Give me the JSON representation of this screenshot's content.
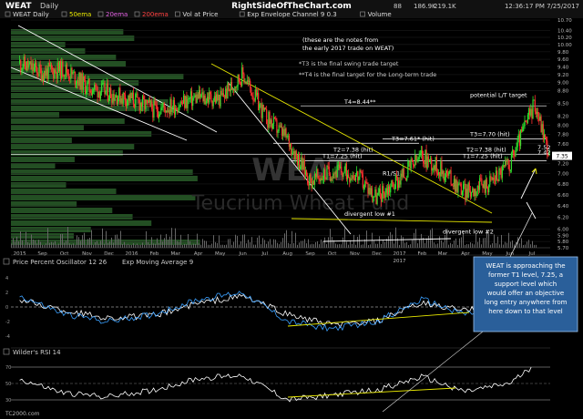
{
  "header": {
    "symbol": "WEAT",
    "period": "Daily",
    "brand": "RightSideOfTheChart.com",
    "stats": [
      "88",
      "186.9K",
      "219.1K"
    ],
    "time": "12:36:17 PM 7/25/2017",
    "legend": [
      {
        "text": "WEAT Daily",
        "color": "#dddddd"
      },
      {
        "text": "50ema",
        "color": "#e8e800"
      },
      {
        "text": "20ema",
        "color": "#e060e0"
      },
      {
        "text": "200ema",
        "color": "#ff4040"
      },
      {
        "text": "Vol at Price",
        "color": "#dddddd"
      },
      {
        "text": "Exp Envelope Channel 9 0.3",
        "color": "#dddddd"
      },
      {
        "text": "Volume",
        "color": "#dddddd"
      }
    ]
  },
  "watermark": {
    "ticker": "WEAT",
    "name": "Teucrium Wheat Fund"
  },
  "notes": {
    "intro": [
      "(these are the notes from",
      "the early 2017 trade on WEAT)"
    ],
    "t3": "*T3 is the final swing trade target",
    "t4": "**T4 is the final target for the Long-term trade"
  },
  "annotations": {
    "t4": "T4=8.44**",
    "potential": "potential L/T target",
    "t3_left": "T3=7.61* (hit)",
    "t3_right": "T3=7.70 (hit)",
    "t2_left": "T2=7.38 (hit)",
    "t2_right": "T2=7.38 (hit)",
    "t1_left": "T1=7.25 (hit)",
    "t1_right": "T1=7.25 (hit)",
    "r1s1": "R1/S1",
    "div1": "divergent low #1",
    "div2": "divergent low #2",
    "year2017": "2017"
  },
  "callout": "WEAT is approaching the former T1 level, 7.25, a support level which would offer an objective long entry anywhere from here down to that level",
  "price_tags": {
    "current": "7.35",
    "upper": "7.52",
    "mid": "7.42"
  },
  "indicators": {
    "ppo": {
      "title": "Price Percent Oscillator 12 26",
      "extra": "Exp Moving Average 9"
    },
    "rsi": {
      "title": "Wilder's RSI 14"
    }
  },
  "footer": {
    "credit": "TC2000.com"
  },
  "colors": {
    "background": "#000000",
    "up_candle": "#2ee02e",
    "down_candle": "#ff3030",
    "target_lines": "#ffffff",
    "trendline_yellow": "#e8e800",
    "callout_bg": "#2a5f9a",
    "volume_at_price": "#2f6a2f"
  },
  "chart_data": [
    {
      "type": "line",
      "title": "WEAT Daily",
      "x_labels": [
        "2015",
        "Sep",
        "Oct",
        "Nov",
        "Dec",
        "2016",
        "Feb",
        "Mar",
        "Apr",
        "May",
        "Jun",
        "Jul",
        "Aug",
        "Sep",
        "Oct",
        "Nov",
        "Dec",
        "2017",
        "Feb",
        "Mar",
        "Apr",
        "May",
        "Jun",
        "Jul"
      ],
      "y_ticks": [
        5.7,
        5.8,
        5.9,
        6.0,
        6.2,
        6.4,
        6.6,
        6.8,
        7.0,
        7.2,
        7.4,
        7.6,
        7.8,
        8.0,
        8.2,
        8.5,
        8.8,
        9.0,
        9.2,
        9.4,
        9.6,
        9.8,
        10.0,
        10.2,
        10.4,
        10.7
      ],
      "ylim": [
        5.7,
        10.7
      ],
      "scale": "log",
      "series": [
        {
          "name": "WEAT",
          "points": [
            [
              "2015-08",
              9.5
            ],
            [
              "2015-09",
              9.25
            ],
            [
              "2015-10",
              9.35
            ],
            [
              "2015-11",
              8.9
            ],
            [
              "2015-12",
              8.75
            ],
            [
              "2016-01",
              8.6
            ],
            [
              "2016-02",
              8.35
            ],
            [
              "2016-03",
              8.45
            ],
            [
              "2016-04",
              8.65
            ],
            [
              "2016-05",
              8.6
            ],
            [
              "2016-06",
              9.2
            ],
            [
              "2016-07",
              8.2
            ],
            [
              "2016-08",
              7.7
            ],
            [
              "2016-09",
              6.85
            ],
            [
              "2016-10",
              7.05
            ],
            [
              "2016-11",
              7.0
            ],
            [
              "2016-12",
              6.55
            ],
            [
              "2017-01",
              6.9
            ],
            [
              "2017-02",
              7.35
            ],
            [
              "2017-03",
              7.05
            ],
            [
              "2017-04",
              6.65
            ],
            [
              "2017-05",
              6.8
            ],
            [
              "2017-06",
              7.2
            ],
            [
              "2017-07-05",
              8.5
            ],
            [
              "2017-07-25",
              7.35
            ]
          ]
        }
      ],
      "levels": [
        8.44,
        7.61,
        7.7,
        7.38,
        7.25
      ],
      "grid": true
    },
    {
      "type": "line",
      "title": "Price Percent Oscillator 12 26",
      "x": [
        "2015-08",
        "2015-10",
        "2015-12",
        "2016-02",
        "2016-04",
        "2016-06",
        "2016-08",
        "2016-10",
        "2016-12",
        "2017-02",
        "2017-04",
        "2017-06",
        "2017-07"
      ],
      "series": [
        {
          "name": "Price Percent Oscillator 12 26",
          "values": [
            1.5,
            -1,
            -2,
            -1,
            1,
            2,
            -2,
            -3,
            -2,
            1,
            -1,
            0,
            3
          ]
        },
        {
          "name": "Exp Moving Average 9",
          "values": [
            1,
            -0.5,
            -1.5,
            -1.2,
            0.5,
            1.5,
            -1,
            -2.5,
            -2,
            0.5,
            -0.5,
            0.2,
            2
          ]
        }
      ]
    },
    {
      "type": "line",
      "title": "Wilder's RSI 14",
      "x": [
        "2015-08",
        "2015-10",
        "2015-12",
        "2016-02",
        "2016-04",
        "2016-06",
        "2016-08",
        "2016-10",
        "2016-12",
        "2017-02",
        "2017-04",
        "2017-06",
        "2017-07"
      ],
      "series": [
        {
          "name": "Wilder's RSI 14",
          "values": [
            55,
            38,
            34,
            42,
            56,
            60,
            30,
            36,
            42,
            58,
            40,
            50,
            70
          ]
        }
      ]
    }
  ]
}
